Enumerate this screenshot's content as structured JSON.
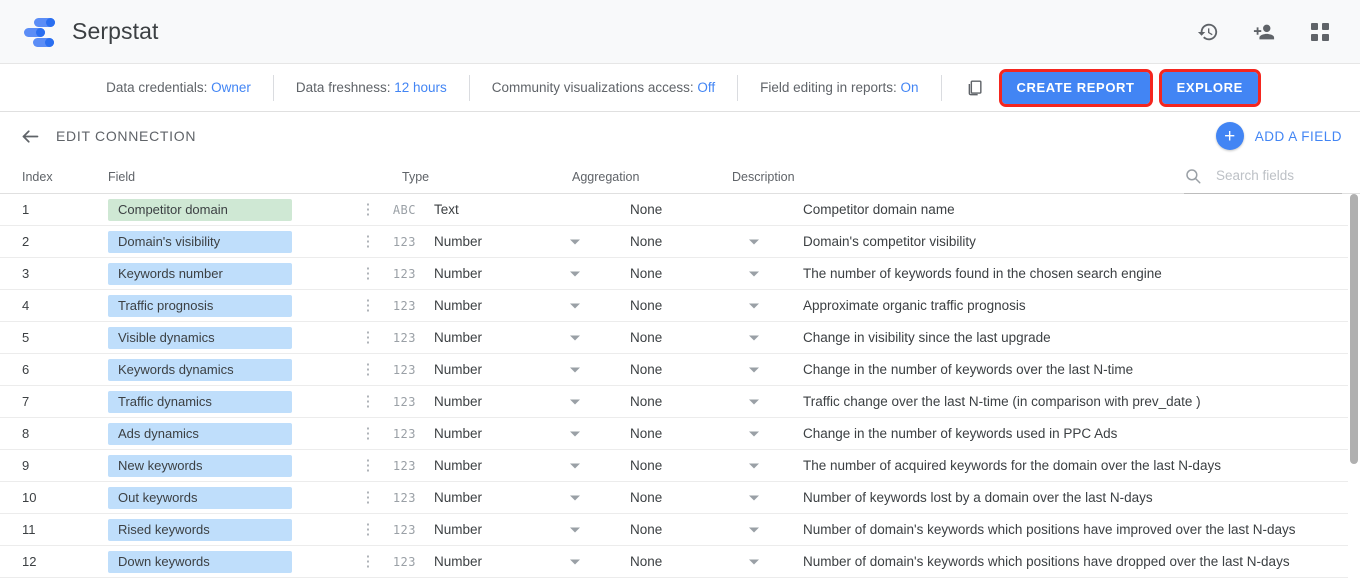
{
  "appbar": {
    "brand": "Serpstat",
    "icons": [
      {
        "name": "version-history-icon",
        "label": "Version history"
      },
      {
        "name": "add-person-icon",
        "label": "Share"
      },
      {
        "name": "apps-grid-icon",
        "label": "Google apps"
      }
    ]
  },
  "toolbar": {
    "meta": [
      {
        "label": "Data credentials:",
        "value": "Owner"
      },
      {
        "label": "Data freshness:",
        "value": "12 hours"
      },
      {
        "label": "Community visualizations access:",
        "value": "Off"
      },
      {
        "label": "Field editing in reports:",
        "value": "On"
      }
    ],
    "copy_icon": "copy-icon",
    "create_report_label": "CREATE REPORT",
    "explore_label": "EXPLORE",
    "accent": "#4285f4",
    "highlight": "#f4261f"
  },
  "pagehead": {
    "back_icon": "arrow-back-icon",
    "title": "EDIT CONNECTION",
    "add_field_label": "ADD A FIELD",
    "add_field_icon": "plus-icon"
  },
  "table": {
    "headers": {
      "index": "Index",
      "field": "Field",
      "type": "Type",
      "aggregation": "Aggregation",
      "description": "Description"
    },
    "search": {
      "placeholder": "Search fields",
      "value": "",
      "icon": "search-icon"
    },
    "rows": [
      {
        "index": "1",
        "field": "Competitor domain",
        "kind": "dimension",
        "type_icon": "ABC",
        "type": "Text",
        "type_caret": false,
        "aggregation": "None",
        "agg_caret": false,
        "description": "Competitor domain name"
      },
      {
        "index": "2",
        "field": "Domain's visibility",
        "kind": "metric",
        "type_icon": "123",
        "type": "Number",
        "type_caret": true,
        "aggregation": "None",
        "agg_caret": true,
        "description": "Domain's competitor visibility"
      },
      {
        "index": "3",
        "field": "Keywords number",
        "kind": "metric",
        "type_icon": "123",
        "type": "Number",
        "type_caret": true,
        "aggregation": "None",
        "agg_caret": true,
        "description": "The number of keywords found in the chosen search engine"
      },
      {
        "index": "4",
        "field": "Traffic prognosis",
        "kind": "metric",
        "type_icon": "123",
        "type": "Number",
        "type_caret": true,
        "aggregation": "None",
        "agg_caret": true,
        "description": "Approximate organic traffic prognosis"
      },
      {
        "index": "5",
        "field": "Visible dynamics",
        "kind": "metric",
        "type_icon": "123",
        "type": "Number",
        "type_caret": true,
        "aggregation": "None",
        "agg_caret": true,
        "description": "Change in visibility since the last upgrade"
      },
      {
        "index": "6",
        "field": "Keywords dynamics",
        "kind": "metric",
        "type_icon": "123",
        "type": "Number",
        "type_caret": true,
        "aggregation": "None",
        "agg_caret": true,
        "description": "Change in the number of keywords over the last N-time"
      },
      {
        "index": "7",
        "field": "Traffic dynamics",
        "kind": "metric",
        "type_icon": "123",
        "type": "Number",
        "type_caret": true,
        "aggregation": "None",
        "agg_caret": true,
        "description": "Traffic change over the last N-time (in comparison with prev_date )"
      },
      {
        "index": "8",
        "field": "Ads dynamics",
        "kind": "metric",
        "type_icon": "123",
        "type": "Number",
        "type_caret": true,
        "aggregation": "None",
        "agg_caret": true,
        "description": "Change in the number of keywords used in PPC Ads"
      },
      {
        "index": "9",
        "field": "New keywords",
        "kind": "metric",
        "type_icon": "123",
        "type": "Number",
        "type_caret": true,
        "aggregation": "None",
        "agg_caret": true,
        "description": "The number of acquired keywords for the domain over the last N-days"
      },
      {
        "index": "10",
        "field": "Out keywords",
        "kind": "metric",
        "type_icon": "123",
        "type": "Number",
        "type_caret": true,
        "aggregation": "None",
        "agg_caret": true,
        "description": "Number of keywords lost by a domain over the last N-days"
      },
      {
        "index": "11",
        "field": "Rised keywords",
        "kind": "metric",
        "type_icon": "123",
        "type": "Number",
        "type_caret": true,
        "aggregation": "None",
        "agg_caret": true,
        "description": "Number of domain's keywords which positions have improved over the last N-days"
      },
      {
        "index": "12",
        "field": "Down keywords",
        "kind": "metric",
        "type_icon": "123",
        "type": "Number",
        "type_caret": true,
        "aggregation": "None",
        "agg_caret": true,
        "description": "Number of domain's keywords which positions have dropped over the last N-days"
      }
    ]
  },
  "colors": {
    "dimension_chip": "#cfe8d4",
    "metric_chip": "#bfdefb",
    "accent_blue": "#4285f4",
    "highlight_red": "#f4261f"
  }
}
